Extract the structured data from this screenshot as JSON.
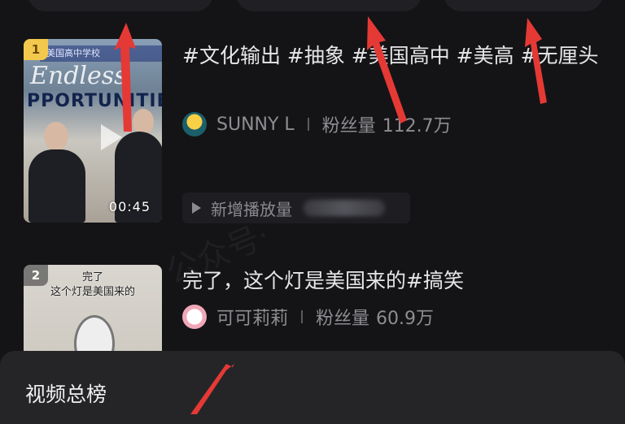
{
  "items": [
    {
      "rank": "1",
      "title": "#文化输出 #抽象 #美国高中 #美高 #无厘头",
      "author": "SUNNY L",
      "fans_label": "粉丝量",
      "fans": "112.7万",
      "duration": "00:45",
      "thumb_banner": "美国高中学校",
      "thumb_word1": "Endless",
      "thumb_word2": "PPORTUNITIE",
      "playcount_label": "新增播放量"
    },
    {
      "rank": "2",
      "title": "完了，这个灯是美国来的#搞笑",
      "author": "可可莉莉",
      "fans_label": "粉丝量",
      "fans": "60.9万",
      "thumb_caption1": "完了",
      "thumb_caption2": "这个灯是美国来的"
    }
  ],
  "watermark": "公众号·",
  "bottom_sheet": {
    "title": "视频总榜"
  },
  "colors": {
    "background": "#141416",
    "annotation_arrow": "#e53935",
    "rank1_badge": "#f2c94c"
  }
}
